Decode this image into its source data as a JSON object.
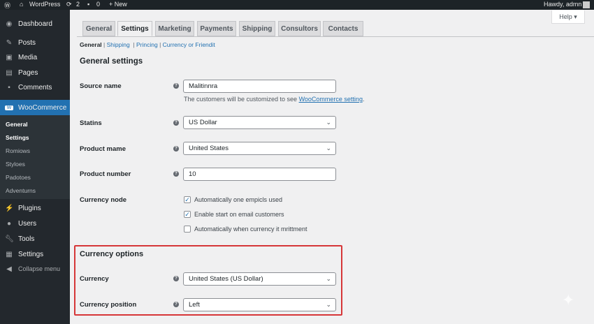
{
  "adminbar": {
    "site": "WordPress",
    "updates": "2",
    "comments": "0",
    "new": "+ New",
    "greeting": "Hawdy, admn"
  },
  "help_button": "Help ▾",
  "sidebar": {
    "items": [
      {
        "label": "Dashboard",
        "icon": "dashboard-icon"
      },
      {
        "label": "Posts",
        "icon": "pin-icon"
      },
      {
        "label": "Media",
        "icon": "media-icon"
      },
      {
        "label": "Pages",
        "icon": "pages-icon"
      },
      {
        "label": "Comments",
        "icon": "comment-icon"
      },
      {
        "label": "WooCommerce",
        "icon": "woo-icon"
      }
    ],
    "submenu": [
      "General",
      "Settings",
      "Romiows",
      "Styloes",
      "Padotoes",
      "Adventurns"
    ],
    "items2": [
      {
        "label": "Plugins",
        "icon": "plugin-icon"
      },
      {
        "label": "Users",
        "icon": "user-icon"
      },
      {
        "label": "Tools",
        "icon": "wrench-icon"
      },
      {
        "label": "Settings",
        "icon": "settings-icon"
      },
      {
        "label": "Collapse menu",
        "icon": "collapse-icon"
      }
    ]
  },
  "tabs": [
    "General",
    "Settings",
    "Marketing",
    "Payments",
    "Shipping",
    "Consultors",
    "Contacts"
  ],
  "sublinks": [
    "General",
    "Shipping",
    "Princing",
    "Currency or Friendit"
  ],
  "section_title": "General settings",
  "fields": {
    "source_name": {
      "label": "Source name",
      "value": "Malitinnra",
      "desc": "The customers will be customized to see ",
      "link": "WooCommerce setting",
      "desc_end": "."
    },
    "statins": {
      "label": "Statins",
      "value": "US Dollar"
    },
    "product_name": {
      "label": "Product mame",
      "value": "United States"
    },
    "product_number": {
      "label": "Product number",
      "value": "10"
    },
    "currency_node": {
      "label": "Currency node",
      "options": [
        {
          "label": "Automatically one empicls used",
          "checked": true
        },
        {
          "label": "Enable start on email customers",
          "checked": true
        },
        {
          "label": "Automatically when currency it mrittment",
          "checked": false
        }
      ]
    }
  },
  "currency_options": {
    "title": "Currency options",
    "highlight_color": "#d63638",
    "currency": {
      "label": "Currency",
      "value": "United States (US Dollar)"
    },
    "position": {
      "label": "Currency position",
      "value": "Left"
    }
  },
  "colors": {
    "accent": "#2271b1",
    "sidebar": "#23282d"
  }
}
